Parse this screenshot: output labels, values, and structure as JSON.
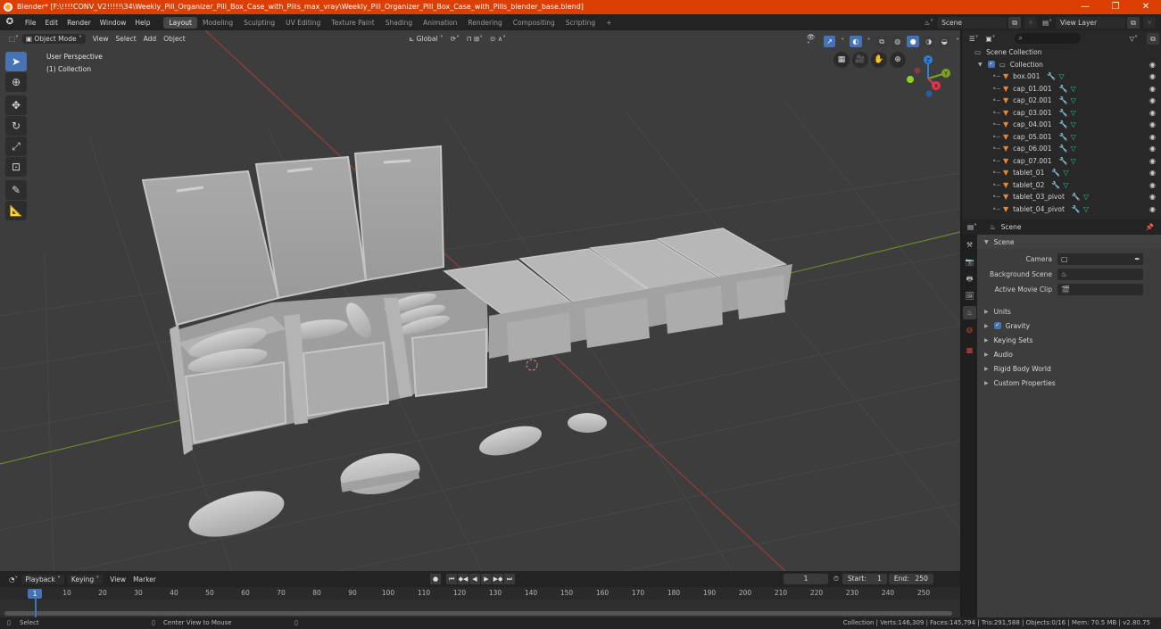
{
  "window": {
    "title": "Blender* [F:\\!!!!CONV_V2!!!!!\\34\\Weekly_Pill_Organizer_Pill_Box_Case_with_Pills_max_vray\\Weekly_Pill_Organizer_Pill_Box_Case_with_Pills_blender_base.blend]",
    "minimize": "—",
    "maximize": "❐",
    "close": "✕"
  },
  "menubar": {
    "items": [
      "File",
      "Edit",
      "Render",
      "Window",
      "Help"
    ],
    "workspaces": [
      "Layout",
      "Modeling",
      "Sculpting",
      "UV Editing",
      "Texture Paint",
      "Shading",
      "Animation",
      "Rendering",
      "Compositing",
      "Scripting"
    ],
    "active_workspace": "Layout",
    "add_workspace": "+",
    "scene": "Scene",
    "view_layer": "View Layer"
  },
  "viewport": {
    "mode": "Object Mode",
    "menus": [
      "View",
      "Select",
      "Add",
      "Object"
    ],
    "orientation": "Global",
    "info_line1": "User Perspective",
    "info_line2": "(1) Collection",
    "tools": [
      "select-box",
      "cursor",
      "move",
      "rotate",
      "scale",
      "transform",
      "annotate",
      "measure"
    ],
    "gizmo_axes": {
      "x": "X",
      "y": "Y",
      "z": "Z"
    },
    "colors": {
      "x_axis": "#c9464b",
      "y_axis": "#7da224",
      "z_axis": "#2d7fd8",
      "bg": "#3d3d3d",
      "mesh": "#bdbdbd"
    }
  },
  "outliner": {
    "scene_collection": "Scene Collection",
    "collection": "Collection",
    "objects": [
      "box.001",
      "cap_01.001",
      "cap_02.001",
      "cap_03.001",
      "cap_04.001",
      "cap_05.001",
      "cap_06.001",
      "cap_07.001",
      "tablet_01",
      "tablet_02",
      "tablet_03_pivot",
      "tablet_04_pivot"
    ]
  },
  "properties": {
    "header": "Scene",
    "panel": "Scene",
    "camera_label": "Camera",
    "bg_scene_label": "Background Scene",
    "movie_clip_label": "Active Movie Clip",
    "subpanels": [
      "Units",
      "Gravity",
      "Keying Sets",
      "Audio",
      "Rigid Body World",
      "Custom Properties"
    ],
    "gravity_checked": true
  },
  "timeline": {
    "menus": [
      "Playback",
      "Keying",
      "View",
      "Marker"
    ],
    "current_frame": "1",
    "start_label": "Start:",
    "start": "1",
    "end_label": "End:",
    "end": "250",
    "ticks": [
      "10",
      "20",
      "30",
      "40",
      "50",
      "60",
      "70",
      "80",
      "90",
      "100",
      "110",
      "120",
      "130",
      "140",
      "150",
      "160",
      "170",
      "180",
      "190",
      "200",
      "210",
      "220",
      "230",
      "240",
      "250"
    ]
  },
  "statusbar": {
    "select": "Select",
    "center_view": "Center View to Mouse",
    "stats": "Collection | Verts:146,309 | Faces:145,794 | Tris:291,588 | Objects:0/16 | Mem: 70.5 MB | v2.80.75"
  }
}
